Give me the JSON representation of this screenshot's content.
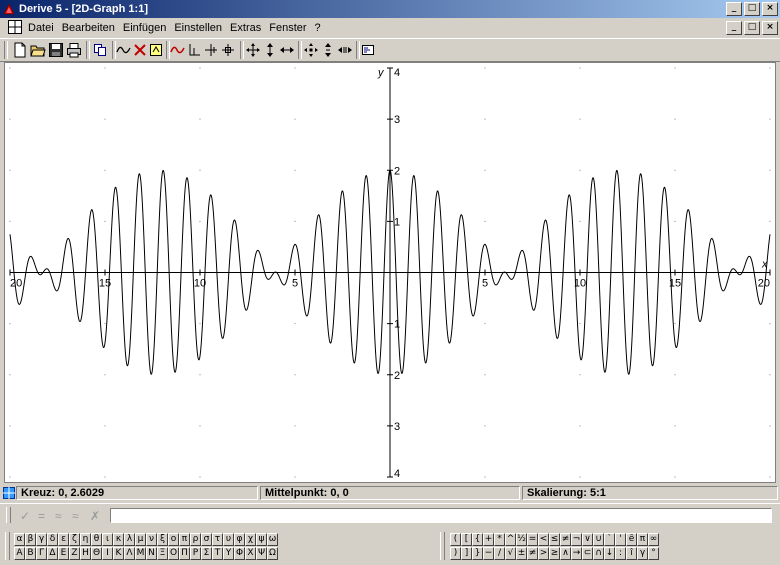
{
  "window": {
    "title": "Derive 5 - [2D-Graph 1:1]",
    "buttons": [
      "_",
      "□",
      "×"
    ]
  },
  "menubar": {
    "items": [
      "Datei",
      "Bearbeiten",
      "Einfügen",
      "Einstellen",
      "Extras",
      "Fenster",
      "?"
    ],
    "mdi_buttons": [
      "_",
      "□",
      "×"
    ]
  },
  "toolbar": {
    "icons": [
      "new-file-icon",
      "open-folder-icon",
      "save-icon",
      "print-icon",
      "copy-icon",
      "plot-icon",
      "delete-icon",
      "highlight-icon",
      "trace-plots-icon",
      "cross-axes-icon",
      "cross-move-icon",
      "center-cross-icon",
      "move-icon",
      "move-vertical-icon",
      "move-horizontal-icon",
      "zoom-in-icon",
      "zoom-vertical-icon",
      "zoom-horizontal-icon",
      "scale-dialog-icon"
    ]
  },
  "graph": {
    "x_range": [
      -20,
      20
    ],
    "y_range": [
      -4,
      4
    ],
    "x_label": "x",
    "y_label": "y",
    "x_ticks": [
      {
        "value": -20,
        "label": "20"
      },
      {
        "value": -15,
        "label": "15"
      },
      {
        "value": -10,
        "label": "10"
      },
      {
        "value": -5,
        "label": "5"
      },
      {
        "value": 5,
        "label": "5"
      },
      {
        "value": 10,
        "label": "10"
      },
      {
        "value": 15,
        "label": "15"
      },
      {
        "value": 20,
        "label": "20"
      }
    ],
    "y_ticks": [
      {
        "value": 4,
        "label": "4"
      },
      {
        "value": 3,
        "label": "3"
      },
      {
        "value": 2,
        "label": "2"
      },
      {
        "value": 1,
        "label": "1"
      },
      {
        "value": -1,
        "label": "1"
      },
      {
        "value": -2,
        "label": "2"
      },
      {
        "value": -3,
        "label": "3"
      },
      {
        "value": -4,
        "label": "4"
      }
    ],
    "curve": {
      "type": "line",
      "amplitude": 2,
      "carrier_frequency": 2.5,
      "envelope_frequency": 0.258,
      "color": "#000000"
    }
  },
  "status": {
    "cross": "Kreuz: 0, 2.6029",
    "center": "Mittelpunkt: 0, 0",
    "scale": "Skalierung: 5:1"
  },
  "editbar": {
    "symbols": [
      "✓",
      "=",
      "≈",
      "≈",
      "✗"
    ],
    "input_value": ""
  },
  "greek": {
    "lower": [
      "α",
      "β",
      "γ",
      "δ",
      "ε",
      "ζ",
      "η",
      "θ",
      "ι",
      "κ",
      "λ",
      "μ",
      "ν",
      "ξ",
      "ο",
      "π",
      "ρ",
      "σ",
      "τ",
      "υ",
      "φ",
      "χ",
      "ψ",
      "ω"
    ],
    "upper": [
      "Α",
      "Β",
      "Γ",
      "Δ",
      "Ε",
      "Ζ",
      "Η",
      "Θ",
      "Ι",
      "Κ",
      "Λ",
      "Μ",
      "Ν",
      "Ξ",
      "Ο",
      "Π",
      "Ρ",
      "Σ",
      "Τ",
      "Υ",
      "Φ",
      "Χ",
      "Ψ",
      "Ω"
    ]
  },
  "math_symbols": {
    "row1": [
      "(",
      "[",
      "{",
      "+",
      "*",
      "^",
      "½",
      "=",
      "<",
      "≤",
      "≠",
      "¬",
      "∨",
      "∪",
      "`",
      "'",
      "ê",
      "π",
      "∞"
    ],
    "row2": [
      ")",
      "]",
      "}",
      "−",
      "/",
      "√",
      "±",
      "≠",
      ">",
      "≥",
      "∧",
      "→",
      "⊂",
      "∩",
      "↓",
      ":",
      "î",
      "γ",
      "°"
    ]
  }
}
